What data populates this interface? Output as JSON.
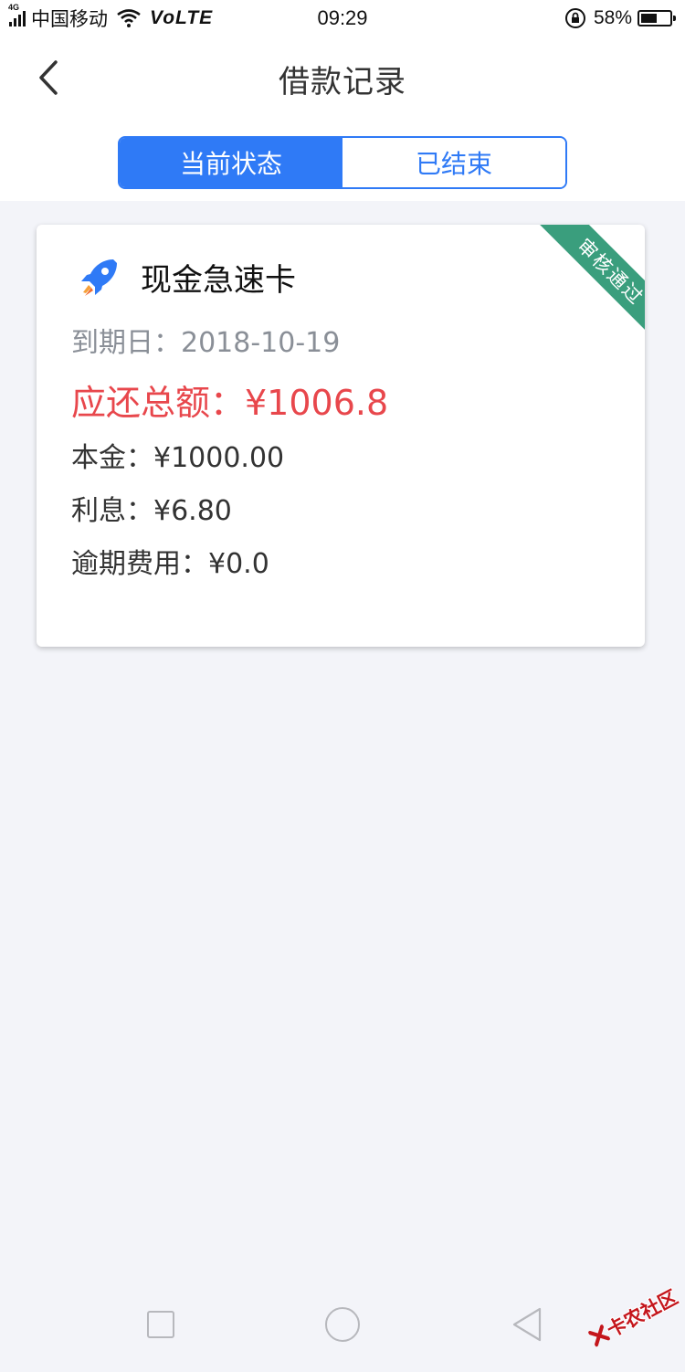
{
  "status_bar": {
    "network_tag": "4G",
    "carrier": "中国移动",
    "volte": "VoLTE",
    "time": "09:29",
    "battery_percent": "58%",
    "battery_level": 0.58
  },
  "header": {
    "title": "借款记录",
    "back_icon": "chevron-left-icon"
  },
  "tabs": [
    {
      "label": "当前状态",
      "active": true
    },
    {
      "label": "已结束",
      "active": false
    }
  ],
  "loan_card": {
    "icon": "rocket-icon",
    "product_name": "现金急速卡",
    "ribbon": "审核通过",
    "due_date": "到期日：2018-10-19",
    "total_due": "应还总额：¥1006.8",
    "principal": "本金：¥1000.00",
    "interest": "利息：¥6.80",
    "overdue_fee": "逾期费用：¥0.0"
  },
  "nav": {
    "square_icon": "recent-apps-icon",
    "circle_icon": "home-icon",
    "triangle_icon": "back-triangle-icon"
  },
  "watermark": {
    "text": "卡农社区"
  },
  "colors": {
    "accent": "#2f7af6",
    "danger": "#e8474c",
    "ribbon": "#3a9e7d",
    "background": "#f3f4f9"
  }
}
